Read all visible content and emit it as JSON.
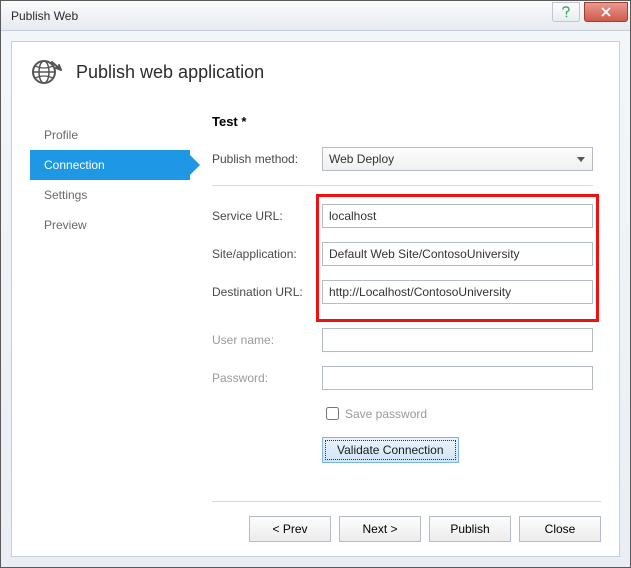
{
  "window": {
    "title": "Publish Web"
  },
  "header": {
    "title": "Publish web application"
  },
  "sidebar": {
    "items": [
      {
        "label": "Profile"
      },
      {
        "label": "Connection"
      },
      {
        "label": "Settings"
      },
      {
        "label": "Preview"
      }
    ],
    "activeIndex": 1
  },
  "main": {
    "section_title": "Test *",
    "publish_method_label": "Publish method:",
    "publish_method_value": "Web Deploy",
    "service_url_label": "Service URL:",
    "service_url_value": "localhost",
    "site_app_label": "Site/application:",
    "site_app_value": "Default Web Site/ContosoUniversity",
    "dest_url_label": "Destination URL:",
    "dest_url_value": "http://Localhost/ContosoUniversity",
    "username_label": "User name:",
    "username_value": "",
    "password_label": "Password:",
    "password_value": "",
    "save_password_label": "Save password",
    "validate_label": "Validate Connection"
  },
  "footer": {
    "prev": "< Prev",
    "next": "Next >",
    "publish": "Publish",
    "close": "Close"
  }
}
